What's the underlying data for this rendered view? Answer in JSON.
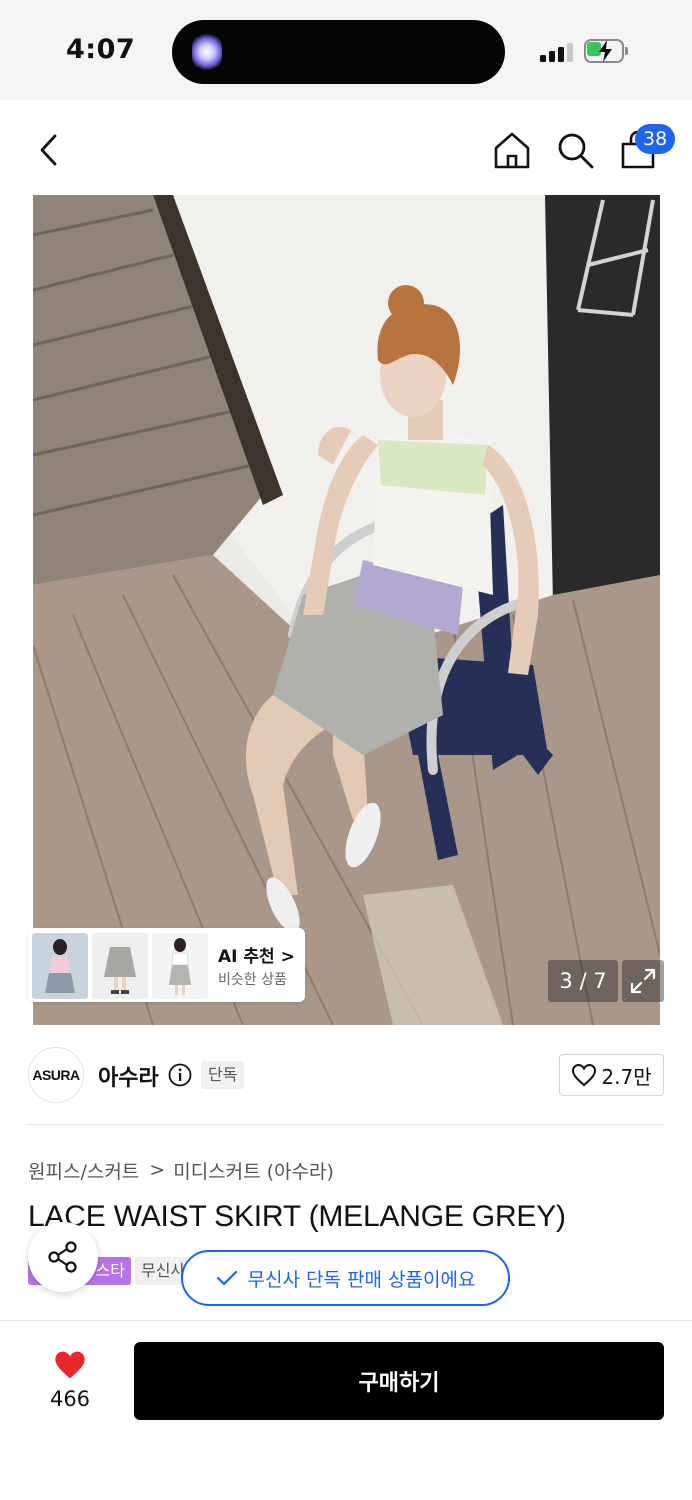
{
  "status_bar": {
    "time": "4:07"
  },
  "header": {
    "icons": [
      "back-icon",
      "home-icon",
      "search-icon",
      "cart-icon"
    ],
    "cart_badge": "38"
  },
  "gallery": {
    "counter": "3 / 7",
    "ai_recommend": {
      "title": "AI 추천 >",
      "subtitle": "비슷한 상품"
    }
  },
  "brand": {
    "logo_text": "ASURA",
    "name": "아수라",
    "exclusive_tag": "단독",
    "like_count": "2.7만"
  },
  "breadcrumb": {
    "category": "원피스/스커트",
    "separator": ">",
    "subcategory": "미디스커트 (아수라)"
  },
  "product": {
    "title": "LACE WAIST SKIRT (MELANGE GREY)",
    "tag_purple": "스타",
    "tag_gray": "무신사"
  },
  "toast": {
    "text": "무신사 단독 판매 상품이에요"
  },
  "bottom_bar": {
    "wish_count": "466",
    "buy_label": "구매하기"
  },
  "colors": {
    "accent_blue": "#1f64f0",
    "tag_purple": "#b673e8",
    "heart_red": "#e8262b",
    "buy_black": "#000000"
  }
}
